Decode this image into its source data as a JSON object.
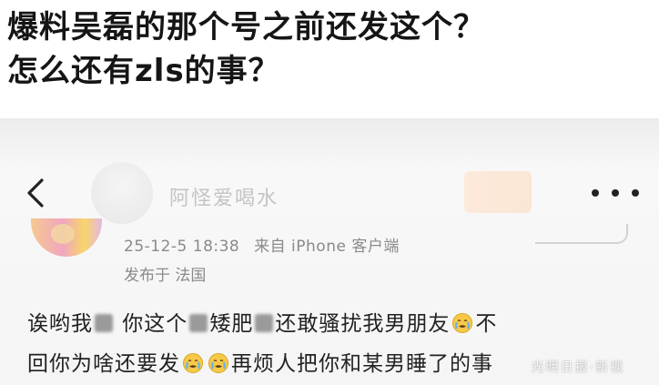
{
  "headline": {
    "line1": "爆料吴磊的那个号之前还发这个？",
    "line2": "怎么还有zls的事？"
  },
  "post": {
    "author_name": "阿怪爱喝水",
    "date": "25-12-5 18:38",
    "source": "来自 iPhone 客户端",
    "location": "发布于 法国",
    "body": {
      "seg1": "诶哟我",
      "seg2": " 你这个",
      "seg3": "矮肥",
      "seg4": "还敢骚扰我男朋友",
      "seg5": "不",
      "seg6": "回你为啥还要发",
      "seg7": "再烦人把你和某男睡了的事"
    }
  },
  "icons": {
    "back": "chevron-left-icon",
    "more": "more-horizontal-icon",
    "emoji": "crying-emoji-icon"
  },
  "watermark": "光明日报·新视"
}
